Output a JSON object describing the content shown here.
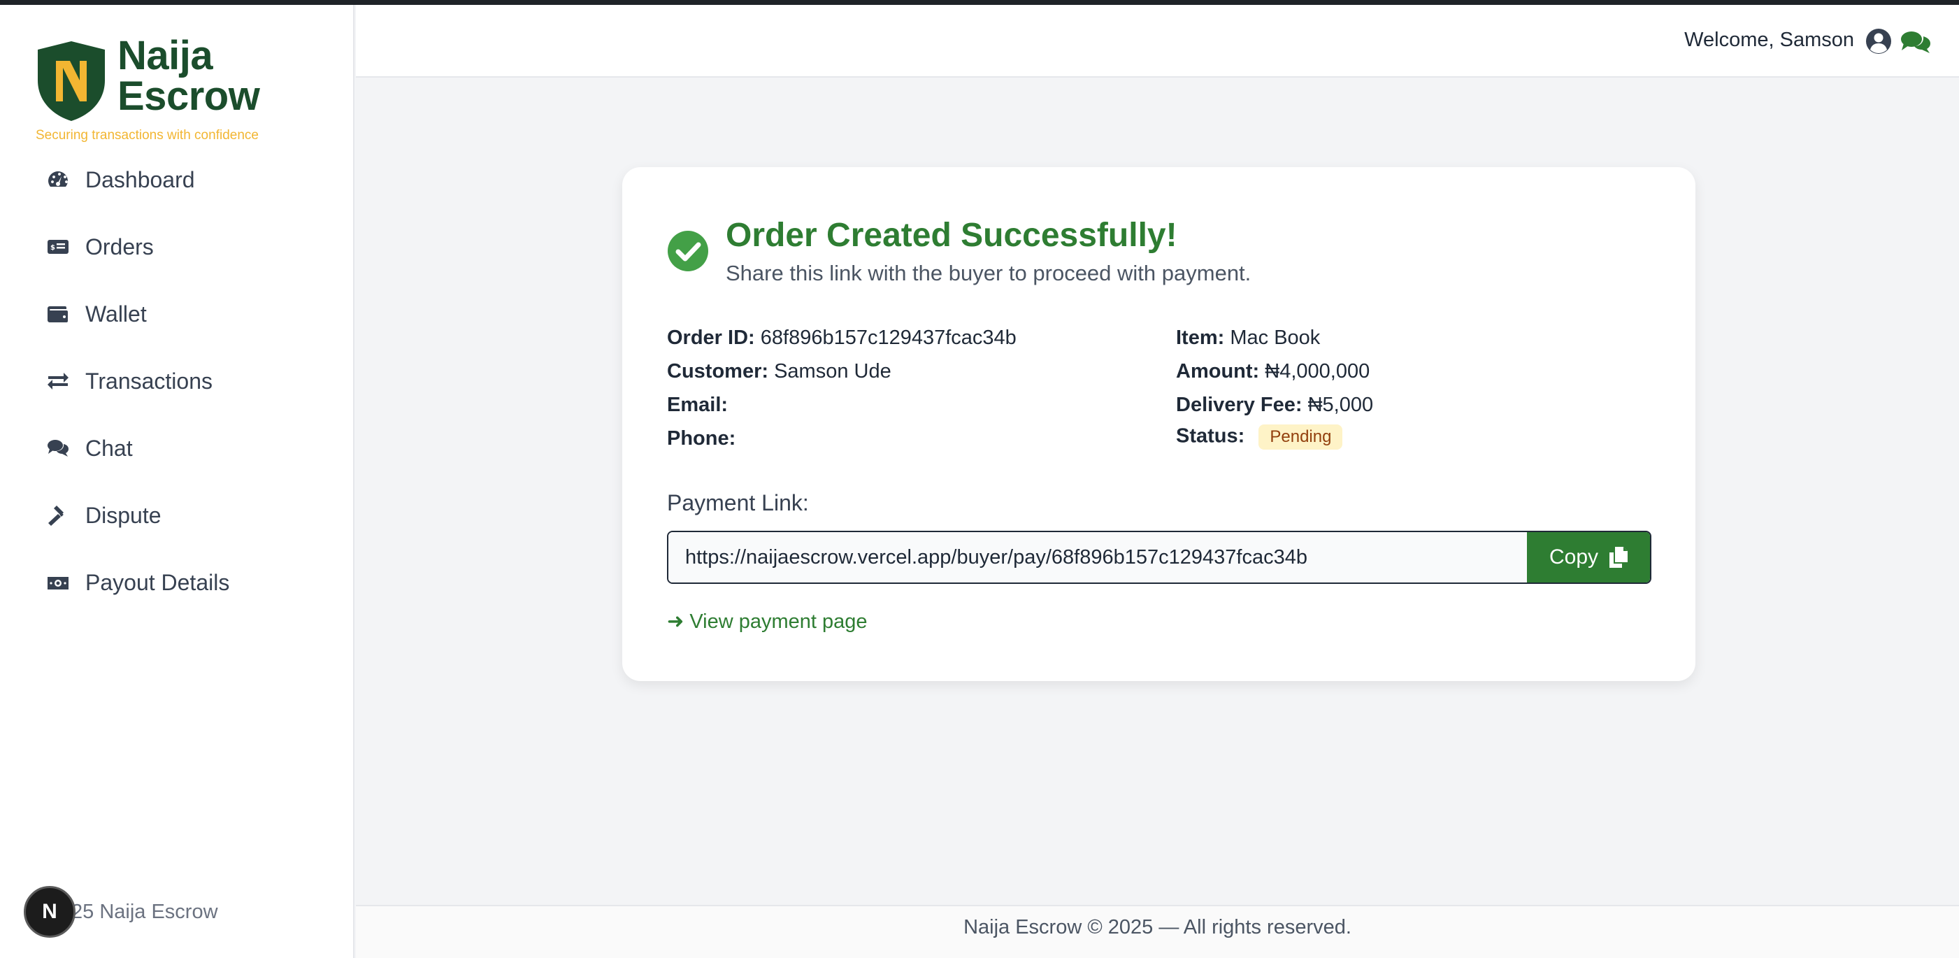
{
  "brand": {
    "logo_letter": "N",
    "name_line1": "Naija",
    "name_line2": "Escrow",
    "tagline": "Securing transactions with confidence",
    "primary_color": "#1b4d2c",
    "accent_color": "#f2b632"
  },
  "sidebar": {
    "items": [
      {
        "label": "Dashboard",
        "icon": "dashboard-gauge-icon"
      },
      {
        "label": "Orders",
        "icon": "orders-card-icon"
      },
      {
        "label": "Wallet",
        "icon": "wallet-icon"
      },
      {
        "label": "Transactions",
        "icon": "transfer-arrows-icon"
      },
      {
        "label": "Chat",
        "icon": "chat-bubbles-icon"
      },
      {
        "label": "Dispute",
        "icon": "gavel-icon"
      },
      {
        "label": "Payout Details",
        "icon": "money-bill-icon"
      }
    ],
    "footer_badge": "N",
    "footer_text": "25 Naija Escrow"
  },
  "header": {
    "welcome": "Welcome, Samson"
  },
  "card": {
    "title": "Order Created Successfully!",
    "subtitle": "Share this link with the buyer to proceed with payment.",
    "success_color": "#2e7d32",
    "details": {
      "order_id_label": "Order ID:",
      "order_id": "68f896b157c129437fcac34b",
      "customer_label": "Customer:",
      "customer": "Samson Ude",
      "email_label": "Email:",
      "email": "",
      "phone_label": "Phone:",
      "phone": "",
      "item_label": "Item:",
      "item": "Mac Book",
      "amount_label": "Amount:",
      "amount": "₦4,000,000",
      "delivery_label": "Delivery Fee:",
      "delivery": "₦5,000",
      "status_label": "Status:",
      "status": "Pending"
    },
    "payment_link_label": "Payment Link:",
    "payment_link": "https://naijaescrow.vercel.app/buyer/pay/68f896b157c129437fcac34b",
    "copy_label": "Copy",
    "view_link": "➜ View payment page"
  },
  "footer": {
    "text": "Naija Escrow © 2025 — All rights reserved."
  }
}
